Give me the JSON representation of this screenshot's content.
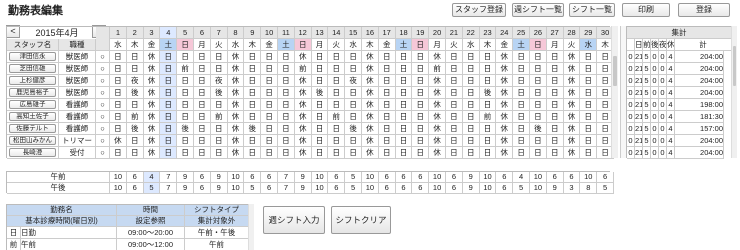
{
  "title": "勤務表編集",
  "toolbar": {
    "staff_register": "スタッフ登録",
    "week_shift_list": "週シフト一覧",
    "shift_list": "シフト一覧",
    "print": "印刷",
    "register": "登録"
  },
  "month_label": "2015年4月",
  "nav": {
    "prev": "<",
    "next": ">"
  },
  "headers": {
    "staff_name": "スタッフ名",
    "job_type": "職種",
    "summary": "集計"
  },
  "days": [
    {
      "d": "1",
      "w": "水",
      "c": ""
    },
    {
      "d": "2",
      "w": "木",
      "c": ""
    },
    {
      "d": "3",
      "w": "金",
      "c": ""
    },
    {
      "d": "4",
      "w": "土",
      "c": "sat"
    },
    {
      "d": "5",
      "w": "日",
      "c": "sun"
    },
    {
      "d": "6",
      "w": "月",
      "c": ""
    },
    {
      "d": "7",
      "w": "火",
      "c": ""
    },
    {
      "d": "8",
      "w": "水",
      "c": ""
    },
    {
      "d": "9",
      "w": "木",
      "c": ""
    },
    {
      "d": "10",
      "w": "金",
      "c": ""
    },
    {
      "d": "11",
      "w": "土",
      "c": "sat"
    },
    {
      "d": "12",
      "w": "日",
      "c": "sun"
    },
    {
      "d": "13",
      "w": "月",
      "c": ""
    },
    {
      "d": "14",
      "w": "火",
      "c": ""
    },
    {
      "d": "15",
      "w": "水",
      "c": ""
    },
    {
      "d": "16",
      "w": "木",
      "c": ""
    },
    {
      "d": "17",
      "w": "金",
      "c": ""
    },
    {
      "d": "18",
      "w": "土",
      "c": "sat"
    },
    {
      "d": "19",
      "w": "日",
      "c": "sun"
    },
    {
      "d": "20",
      "w": "月",
      "c": ""
    },
    {
      "d": "21",
      "w": "火",
      "c": ""
    },
    {
      "d": "22",
      "w": "水",
      "c": ""
    },
    {
      "d": "23",
      "w": "木",
      "c": ""
    },
    {
      "d": "24",
      "w": "金",
      "c": ""
    },
    {
      "d": "25",
      "w": "土",
      "c": "sat"
    },
    {
      "d": "26",
      "w": "日",
      "c": "sun"
    },
    {
      "d": "27",
      "w": "月",
      "c": ""
    },
    {
      "d": "28",
      "w": "火",
      "c": ""
    },
    {
      "d": "29",
      "w": "水",
      "c": "sat"
    },
    {
      "d": "30",
      "w": "木",
      "c": ""
    }
  ],
  "summary_headers": [
    "日",
    "前",
    "後",
    "夜",
    "休",
    "計"
  ],
  "staff": [
    {
      "name": "津田信永",
      "job": "獣医師",
      "mark": "○",
      "shifts": [
        "日",
        "日",
        "休",
        "日",
        "日",
        "日",
        "日",
        "休",
        "日",
        "日",
        "日",
        "休",
        "日",
        "日",
        "日",
        "休",
        "日",
        "日",
        "日",
        "休",
        "日",
        "日",
        "日",
        "休",
        "日",
        "日",
        "日",
        "休",
        "日",
        "日"
      ],
      "summary": [
        "0",
        "21",
        "5",
        "0",
        "0",
        "4",
        "204:00"
      ]
    },
    {
      "name": "芝田信雄",
      "job": "獣医師",
      "mark": "○",
      "shifts": [
        "日",
        "日",
        "休",
        "日",
        "前",
        "日",
        "日",
        "休",
        "日",
        "日",
        "日",
        "前",
        "日",
        "日",
        "日",
        "休",
        "日",
        "日",
        "日",
        "前",
        "日",
        "日",
        "日",
        "休",
        "日",
        "日",
        "日",
        "休",
        "日",
        "日"
      ],
      "summary": [
        "0",
        "21",
        "5",
        "0",
        "0",
        "4",
        "204:00"
      ]
    },
    {
      "name": "上杉健彦",
      "job": "獣医師",
      "mark": "○",
      "shifts": [
        "日",
        "夜",
        "休",
        "日",
        "日",
        "日",
        "夜",
        "休",
        "日",
        "日",
        "日",
        "休",
        "日",
        "日",
        "夜",
        "休",
        "日",
        "日",
        "日",
        "休",
        "日",
        "日",
        "日",
        "休",
        "日",
        "日",
        "日",
        "休",
        "日",
        "日"
      ],
      "summary": [
        "0",
        "21",
        "5",
        "0",
        "0",
        "4",
        "204:00"
      ]
    },
    {
      "name": "鹿児島裕子",
      "job": "獣医師",
      "mark": "○",
      "shifts": [
        "日",
        "後",
        "休",
        "日",
        "日",
        "日",
        "後",
        "休",
        "日",
        "日",
        "日",
        "休",
        "後",
        "日",
        "日",
        "休",
        "日",
        "日",
        "日",
        "休",
        "日",
        "日",
        "後",
        "休",
        "日",
        "日",
        "日",
        "休",
        "日",
        "日"
      ],
      "summary": [
        "0",
        "21",
        "5",
        "0",
        "0",
        "4",
        "204:00"
      ]
    },
    {
      "name": "広島雄子",
      "job": "看護師",
      "mark": "○",
      "shifts": [
        "日",
        "日",
        "休",
        "日",
        "日",
        "日",
        "日",
        "休",
        "日",
        "日",
        "日",
        "休",
        "日",
        "日",
        "日",
        "休",
        "日",
        "日",
        "日",
        "休",
        "日",
        "日",
        "日",
        "休",
        "日",
        "日",
        "日",
        "休",
        "日",
        "日"
      ],
      "summary": [
        "0",
        "21",
        "5",
        "0",
        "0",
        "4",
        "198:00"
      ]
    },
    {
      "name": "高知土佐子",
      "job": "看護師",
      "mark": "○",
      "shifts": [
        "日",
        "前",
        "休",
        "日",
        "日",
        "日",
        "前",
        "休",
        "日",
        "日",
        "日",
        "休",
        "日",
        "前",
        "日",
        "休",
        "日",
        "日",
        "日",
        "休",
        "日",
        "日",
        "前",
        "休",
        "日",
        "日",
        "日",
        "休",
        "日",
        "日"
      ],
      "summary": [
        "0",
        "21",
        "5",
        "0",
        "0",
        "4",
        "181:30"
      ]
    },
    {
      "name": "佐藤テルト",
      "job": "看護師",
      "mark": "○",
      "shifts": [
        "日",
        "後",
        "休",
        "日",
        "後",
        "日",
        "日",
        "休",
        "後",
        "日",
        "日",
        "休",
        "日",
        "日",
        "後",
        "休",
        "日",
        "日",
        "日",
        "休",
        "日",
        "日",
        "日",
        "休",
        "日",
        "後",
        "日",
        "休",
        "日",
        "日"
      ],
      "summary": [
        "0",
        "21",
        "5",
        "0",
        "0",
        "4",
        "157:00"
      ]
    },
    {
      "name": "松田山みかん",
      "job": "トリマー",
      "mark": "○",
      "shifts": [
        "休",
        "日",
        "休",
        "日",
        "日",
        "日",
        "日",
        "休",
        "日",
        "日",
        "日",
        "休",
        "日",
        "日",
        "日",
        "休",
        "日",
        "日",
        "日",
        "休",
        "日",
        "日",
        "日",
        "休",
        "日",
        "日",
        "日",
        "休",
        "日",
        "日"
      ],
      "summary": [
        "0",
        "21",
        "5",
        "0",
        "0",
        "4",
        "204:00"
      ]
    },
    {
      "name": "長崎澄",
      "job": "受付",
      "mark": "○",
      "shifts": [
        "日",
        "日",
        "休",
        "日",
        "日",
        "日",
        "日",
        "休",
        "日",
        "日",
        "日",
        "休",
        "日",
        "日",
        "日",
        "休",
        "日",
        "日",
        "日",
        "休",
        "日",
        "日",
        "日",
        "休",
        "日",
        "日",
        "日",
        "休",
        "日",
        "日"
      ],
      "summary": [
        "0",
        "21",
        "5",
        "0",
        "0",
        "4",
        "204:00"
      ]
    }
  ],
  "counts": [
    {
      "label": "午前",
      "values": [
        "10",
        "6",
        "4",
        "7",
        "9",
        "6",
        "9",
        "10",
        "6",
        "6",
        "7",
        "9",
        "10",
        "6",
        "5",
        "10",
        "6",
        "6",
        "6",
        "10",
        "6",
        "9",
        "10",
        "6",
        "4",
        "10",
        "6",
        "6",
        "10",
        "6"
      ]
    },
    {
      "label": "午後",
      "values": [
        "10",
        "6",
        "5",
        "7",
        "9",
        "6",
        "9",
        "10",
        "5",
        "6",
        "7",
        "9",
        "10",
        "6",
        "5",
        "10",
        "6",
        "6",
        "6",
        "10",
        "6",
        "9",
        "10",
        "6",
        "5",
        "10",
        "9",
        "3",
        "8",
        "5"
      ]
    }
  ],
  "shift_table": {
    "headers": [
      "勤務名",
      "時間",
      "シフトタイプ"
    ],
    "sub_headers": [
      "基本診療時間(曜日別)",
      "設定参照",
      "集計対象外"
    ],
    "rows": [
      {
        "code": "日",
        "name": "日勤",
        "time": "09:00〜20:00",
        "type": "午前・午後"
      },
      {
        "code": "前",
        "name": "午前",
        "time": "09:00〜12:00",
        "type": "午前"
      }
    ]
  },
  "actions": {
    "week_shift_input": "週シフト入力",
    "shift_clear": "シフトクリア"
  },
  "colors": {
    "header_bg": "#e6e6e6",
    "sat_bg": "#b8d4f4",
    "sun_bg": "#f6c8d8",
    "selected_col": "#dde9ff",
    "shift_header_bg": "#c6d9f1"
  }
}
